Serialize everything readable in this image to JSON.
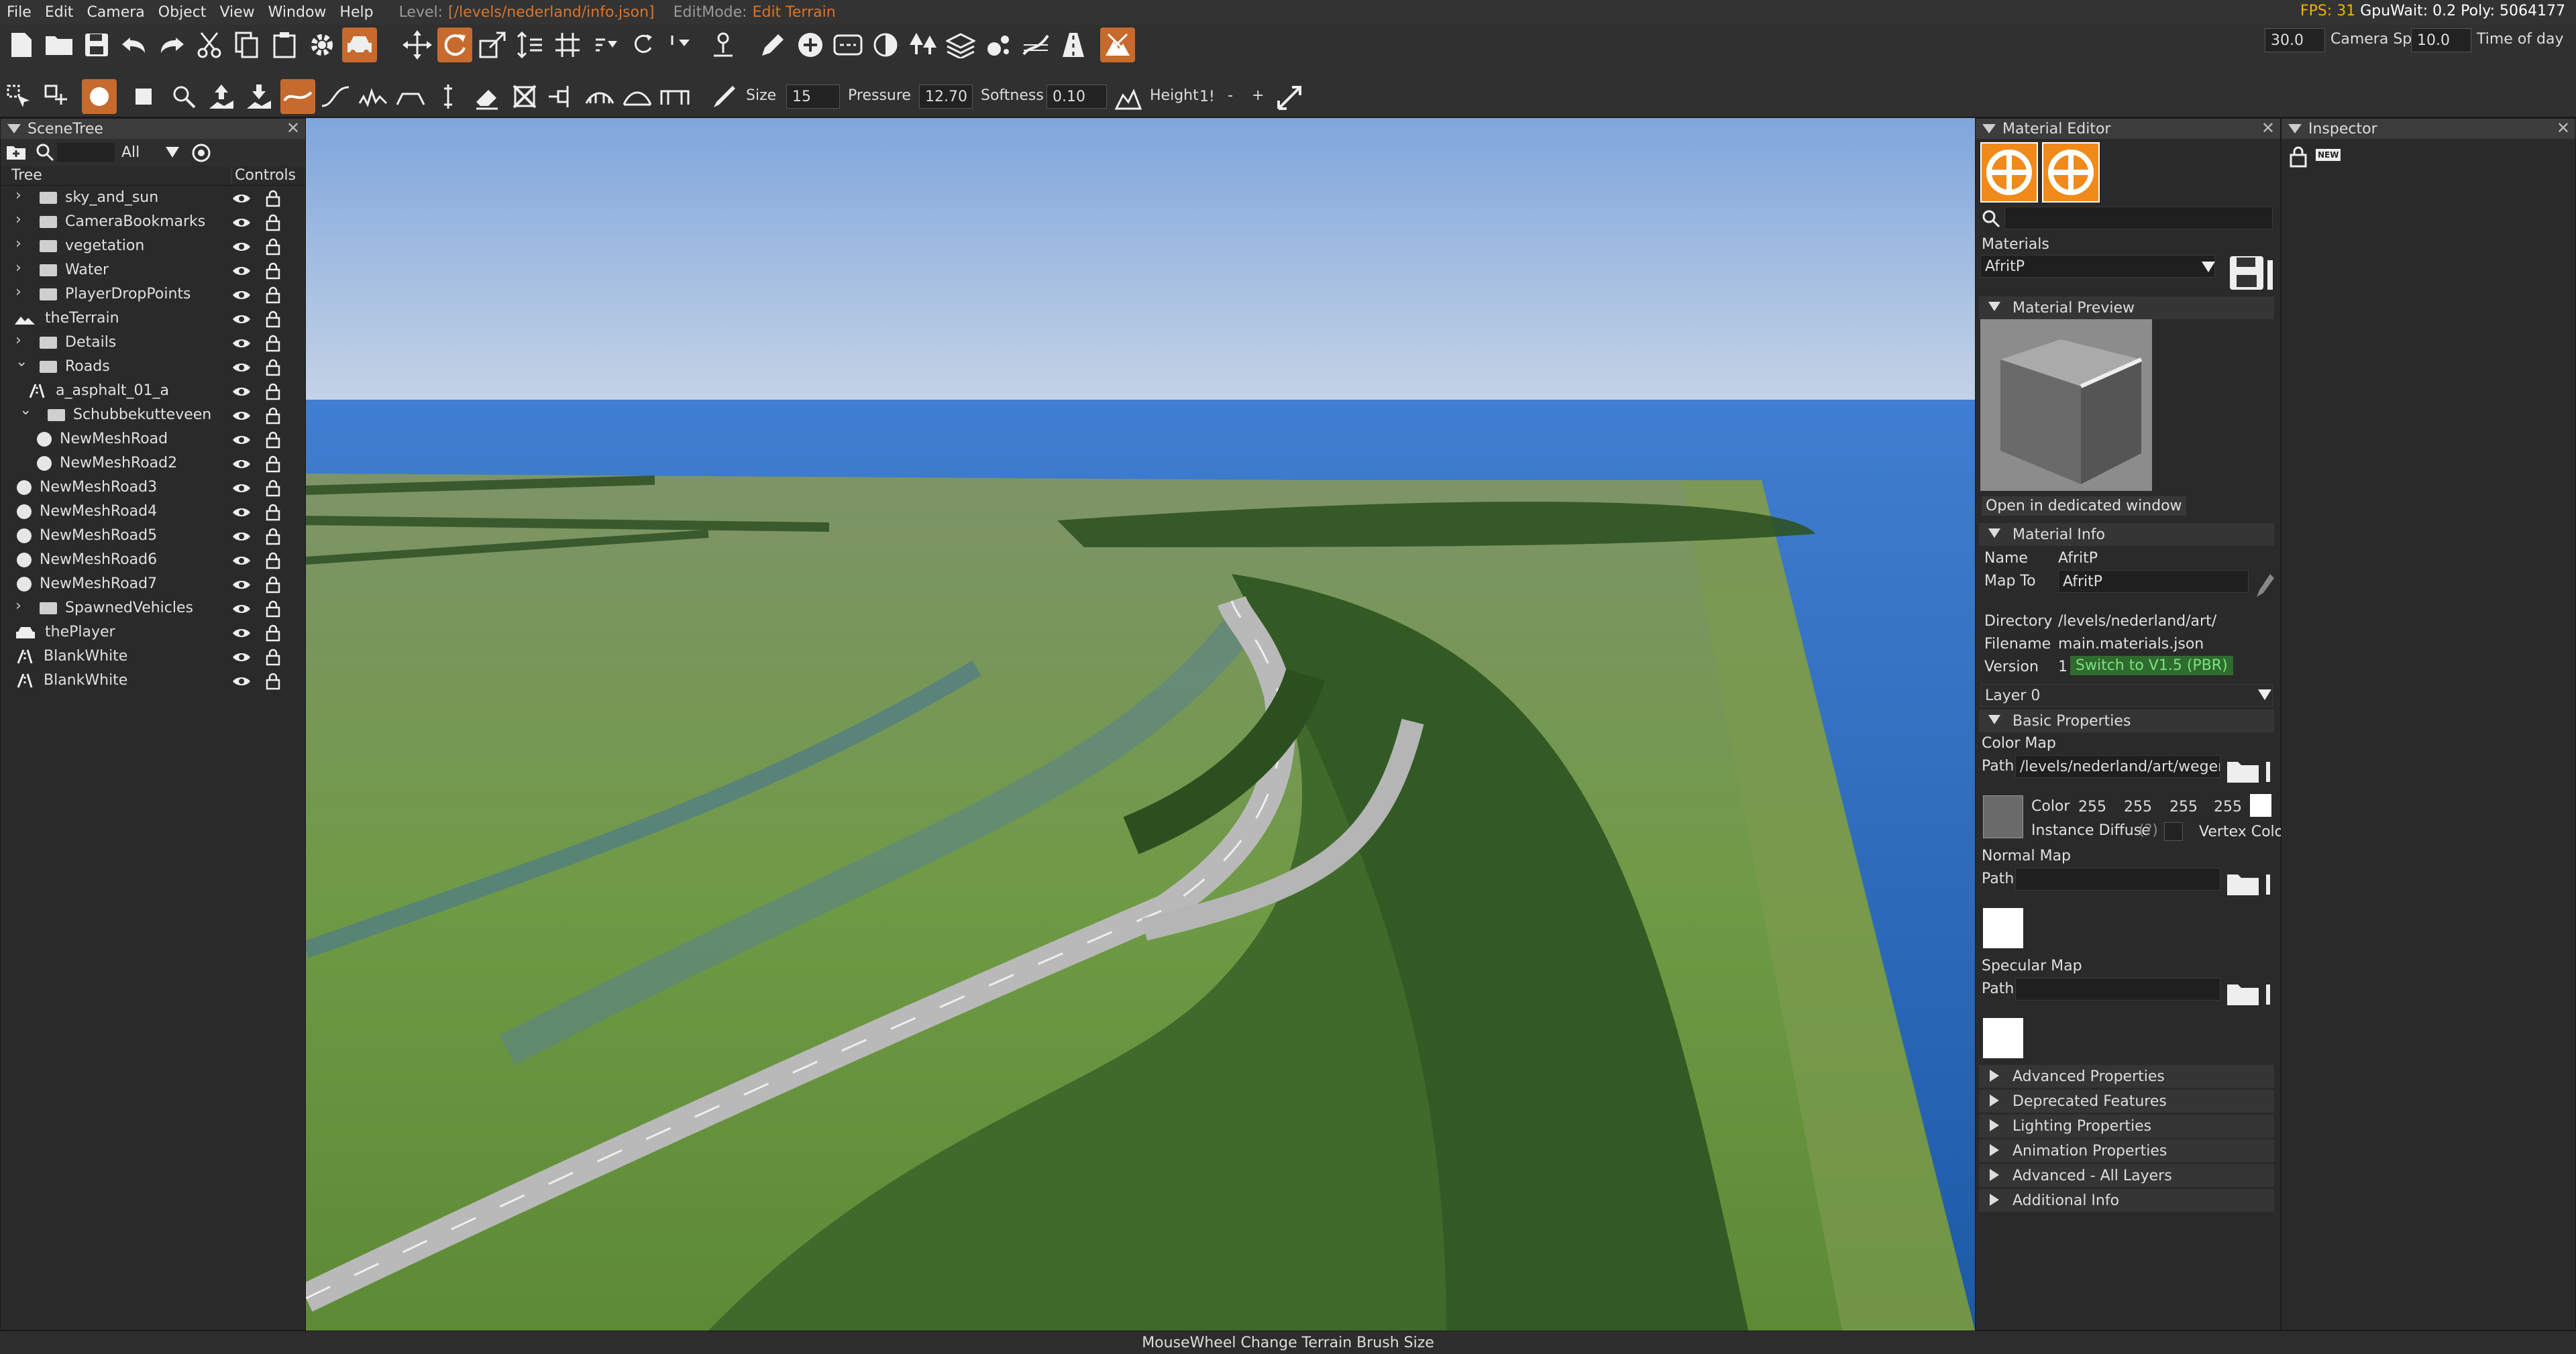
{
  "menu": {
    "items": [
      "File",
      "Edit",
      "Camera",
      "Object",
      "View",
      "Window",
      "Help"
    ],
    "level_label": "Level:",
    "level_path": "[/levels/nederland/info.json]",
    "editmode_label": "EditMode:",
    "editmode_value": "Edit Terrain"
  },
  "stats": {
    "fps_label": "FPS: 31",
    "gpuwait": "GpuWait: 0.2",
    "poly": "Poly: 5064177"
  },
  "camera": {
    "speed_value": "30.0",
    "speed_label": "Camera Speed",
    "time_value": "10.0",
    "time_label": "Time of day"
  },
  "brush": {
    "size_label": "Size",
    "size_value": "15",
    "pressure_label": "Pressure",
    "pressure_value": "12.70",
    "softness_label": "Softness",
    "softness_value": "0.10",
    "height_label": "Height",
    "height_value": "1!",
    "minus": "-",
    "plus": "+"
  },
  "scenetree": {
    "title": "SceneTree",
    "filter": "All",
    "col_tree": "Tree",
    "col_controls": "Controls",
    "items": [
      {
        "name": "sky_and_sun",
        "type": "folder",
        "depth": 0,
        "expand": ">"
      },
      {
        "name": "CameraBookmarks",
        "type": "folder",
        "depth": 0,
        "expand": ">"
      },
      {
        "name": "vegetation",
        "type": "folder",
        "depth": 0,
        "expand": ">"
      },
      {
        "name": "Water",
        "type": "folder",
        "depth": 0,
        "expand": ">"
      },
      {
        "name": "PlayerDropPoints",
        "type": "folder",
        "depth": 0,
        "expand": ">"
      },
      {
        "name": "theTerrain",
        "type": "terrain",
        "depth": 0,
        "expand": ""
      },
      {
        "name": "Details",
        "type": "folder",
        "depth": 0,
        "expand": ">"
      },
      {
        "name": "Roads",
        "type": "folder",
        "depth": 0,
        "expand": "v"
      },
      {
        "name": "a_asphalt_01_a",
        "type": "road",
        "depth": 1,
        "expand": ""
      },
      {
        "name": "Schubbekutteveen",
        "type": "folder",
        "depth": 1,
        "expand": "v"
      },
      {
        "name": "NewMeshRoad",
        "type": "circle",
        "depth": 2,
        "expand": ""
      },
      {
        "name": "NewMeshRoad2",
        "type": "circle",
        "depth": 2,
        "expand": ""
      },
      {
        "name": "NewMeshRoad3",
        "type": "circle",
        "depth": 0,
        "expand": ""
      },
      {
        "name": "NewMeshRoad4",
        "type": "circle",
        "depth": 0,
        "expand": ""
      },
      {
        "name": "NewMeshRoad5",
        "type": "circle",
        "depth": 0,
        "expand": ""
      },
      {
        "name": "NewMeshRoad6",
        "type": "circle",
        "depth": 0,
        "expand": ""
      },
      {
        "name": "NewMeshRoad7",
        "type": "circle",
        "depth": 0,
        "expand": ""
      },
      {
        "name": "SpawnedVehicles",
        "type": "folder",
        "depth": 0,
        "expand": ">"
      },
      {
        "name": "thePlayer",
        "type": "car",
        "depth": 0,
        "expand": ""
      },
      {
        "name": "BlankWhite",
        "type": "road",
        "depth": 0,
        "expand": ""
      },
      {
        "name": "BlankWhite",
        "type": "road",
        "depth": 0,
        "expand": ""
      }
    ]
  },
  "material_editor": {
    "title": "Material Editor",
    "materials_label": "Materials",
    "material_selected": "AfritP",
    "preview_section": "Material Preview",
    "open_dedicated": "Open in dedicated window",
    "info_section": "Material Info",
    "name_label": "Name",
    "name_value": "AfritP",
    "mapto_label": "Map To",
    "mapto_value": "AfritP",
    "directory_label": "Directory",
    "directory_value": "/levels/nederland/art/",
    "filename_label": "Filename",
    "filename_value": "main.materials.json",
    "version_label": "Version",
    "version_value": "1",
    "switch_button": "Switch to V1.5 (PBR)",
    "layer": "Layer 0",
    "basic_section": "Basic Properties",
    "color_map_label": "Color Map",
    "path_label": "Path",
    "color_map_path": "/levels/nederland/art/wegen/F",
    "color_label": "Color",
    "color_r": "255",
    "color_g": "255",
    "color_b": "255",
    "color_a": "255",
    "instance_diffuse": "Instance Diffuse",
    "instance_help": "(?)",
    "vertex_color": "Vertex Colo",
    "normal_map_label": "Normal Map",
    "specular_map_label": "Specular Map",
    "collapsed_sections": [
      "Advanced Properties",
      "Deprecated Features",
      "Lighting Properties",
      "Animation Properties",
      "Advanced - All Layers",
      "Additional Info"
    ]
  },
  "inspector": {
    "title": "Inspector",
    "new_badge": "NEW"
  },
  "statusbar": {
    "text": "MouseWheel  Change Terrain Brush Size"
  },
  "colors": {
    "accent": "#c76a2e",
    "fps": "#f0b400",
    "switch_bg": "#2f6b2f",
    "switch_text": "#7de07d"
  }
}
